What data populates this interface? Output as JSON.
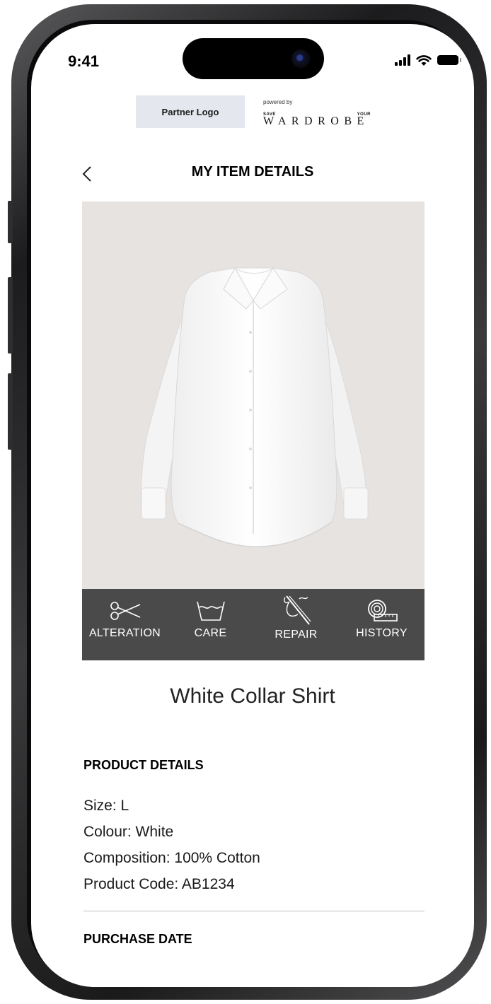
{
  "status_bar": {
    "time": "9:41"
  },
  "header": {
    "partner_logo": "Partner Logo",
    "powered_by": "powered by",
    "brand_top_left": "SAVE",
    "brand_top_right": "YOUR",
    "brand_word": "WARDROBE"
  },
  "nav": {
    "title": "MY ITEM DETAILS"
  },
  "item": {
    "photo_icon": "white-shirt-image",
    "name": "White Collar Shirt"
  },
  "actions": [
    {
      "label": "ALTERATION",
      "icon": "scissors-icon"
    },
    {
      "label": "CARE",
      "icon": "wash-basin-icon"
    },
    {
      "label": "REPAIR",
      "icon": "needle-thread-icon"
    },
    {
      "label": "HISTORY",
      "icon": "measuring-tape-icon"
    }
  ],
  "product_details": {
    "title": "PRODUCT DETAILS",
    "size": "Size: L",
    "colour": "Colour: White",
    "composition": "Composition: 100% Cotton",
    "code": "Product Code: AB1234"
  },
  "purchase": {
    "title": "PURCHASE DATE"
  },
  "colors": {
    "action_bar": "#4a4a4a",
    "photo_bg": "#e6e3e1",
    "partner_logo_bg": "#e4e7ee"
  }
}
